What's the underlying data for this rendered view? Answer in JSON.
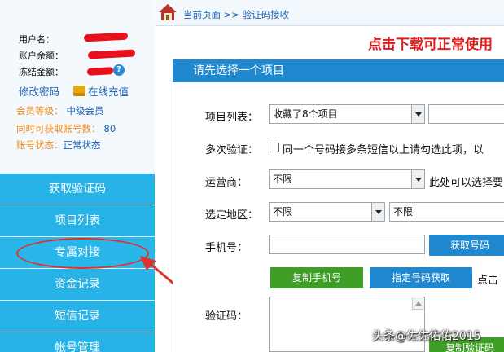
{
  "account": {
    "username_label": "用户名：",
    "balance_label": "账户余额：",
    "frozen_label": "冻结金额：",
    "help_glyph": "?",
    "change_password": "修改密码",
    "online_recharge": "在线充值",
    "member_level_label": "会员等级：",
    "member_level_value": "中级会员",
    "accounts_label": "同时可获取账号数：",
    "accounts_value": "80",
    "status_label": "账号状态：",
    "status_value": "正常状态"
  },
  "nav": {
    "items": [
      {
        "label": "获取验证码"
      },
      {
        "label": "项目列表"
      },
      {
        "label": "专属对接"
      },
      {
        "label": "资金记录"
      },
      {
        "label": "短信记录"
      },
      {
        "label": "帐号管理"
      }
    ]
  },
  "breadcrumb": {
    "text": "当前页面 >> 验证码接收"
  },
  "notice": "点击下载可正常使用",
  "panel": {
    "title": "请先选择一个项目",
    "project_list_label": "项目列表：",
    "project_select_value": "收藏了8个项目",
    "multi_verify_label": "多次验证：",
    "multi_verify_text": "同一个号码接多条短信以上请勾选此项，以",
    "operator_label": "运营商：",
    "operator_value": "不限",
    "operator_hint": "此处可以选择要",
    "region_label": "选定地区：",
    "region_province": "不限",
    "region_city": "不限",
    "phone_label": "手机号：",
    "get_number_button": "获取号码",
    "copy_phone_button": "复制手机号",
    "specify_number_button": "指定号码获取",
    "click_hint": "点击",
    "code_label": "验证码：",
    "copy_code_button": "复制验证码"
  },
  "watermark": "头条@佐佐佑佑2015",
  "colors": {
    "nav_bg": "#27b3e8",
    "panel_header": "#1f88cf",
    "button_green": "#3f9e25",
    "notice_red": "#e01b1b",
    "annotation_red": "#e0322a"
  },
  "icons": {
    "home": "home-icon",
    "recharge": "recharge-icon",
    "help": "help-icon",
    "dropdown": "chevron-down-icon"
  }
}
